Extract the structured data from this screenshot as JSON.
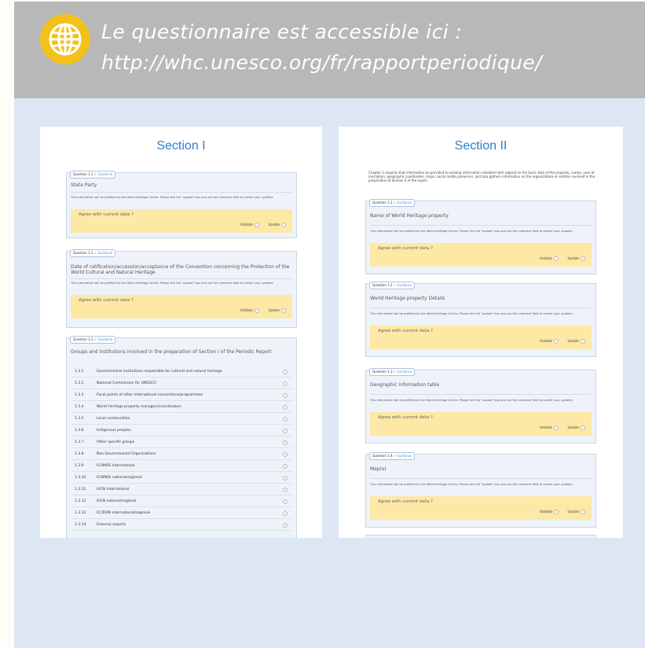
{
  "banner": {
    "line1": "Le questionnaire est accessible ici :",
    "line2": "http://whc.unesco.org/fr/rapportperiodique/",
    "icon": "globe-icon",
    "icon_color": "#f2c21b"
  },
  "common": {
    "question_prefix": "Question",
    "guidance_label": "Guidance",
    "info_text": "This information will be prefilled by the World Heritage Centre. Please tick the \"update\" box and use the comment field to submit your updates",
    "agree_label": "Agree with current data ?",
    "validate_label": "Validate",
    "update_label": "Update"
  },
  "section1": {
    "title": "Section I",
    "q1": {
      "number": "Question 1.1",
      "title": "State Party"
    },
    "q2": {
      "number": "Question 1.2",
      "title": "Date of ratification/accession/acceptance of the Convention concerning the Protection of the World Cultural and Natural Heritage"
    },
    "q3": {
      "number": "Question 1.3",
      "title": "Groups and institutions involved in the preparation of Section I of the Periodic Report",
      "rows": [
        {
          "n": "1.3.1",
          "t": "Governmental institutions responsible for cultural and natural heritage"
        },
        {
          "n": "1.3.2",
          "t": "National Commission for UNESCO"
        },
        {
          "n": "1.3.3",
          "t": "Focal points of other international conventions/programmes"
        },
        {
          "n": "1.3.4",
          "t": "World Heritage property managers/coordinators"
        },
        {
          "n": "1.3.5",
          "t": "Local communities"
        },
        {
          "n": "1.3.6",
          "t": "Indigenous peoples"
        },
        {
          "n": "1.3.7",
          "t": "Other specific groups"
        },
        {
          "n": "1.3.8",
          "t": "Non-Governmental Organizations"
        },
        {
          "n": "1.3.9",
          "t": "ICOMOS International"
        },
        {
          "n": "1.3.10",
          "t": "ICOMOS national/regional"
        },
        {
          "n": "1.3.11",
          "t": "IUCN International"
        },
        {
          "n": "1.3.12",
          "t": "IUCN national/regional"
        },
        {
          "n": "1.3.13",
          "t": "ICCROM international/regional"
        },
        {
          "n": "1.3.14",
          "t": "External experts"
        }
      ]
    }
  },
  "section2": {
    "title": "Section II",
    "intro": "Chapter 1 requires that information be provided to existing information validated with regards to the basic data of the property, (name, year of inscription, geographic coordinates, maps, social media presence), and also gathers information on the organizations or entities involved in the preparation of Section II of the report.",
    "q1": {
      "number": "Question 1.1",
      "title": "Name of World Heritage property"
    },
    "q2": {
      "number": "Question 1.2",
      "title": "World Heritage property Details"
    },
    "q3": {
      "number": "Question 1.3",
      "title": "Geographic information table"
    },
    "q4": {
      "number": "Question 1.4",
      "title": "Map(s)"
    }
  }
}
